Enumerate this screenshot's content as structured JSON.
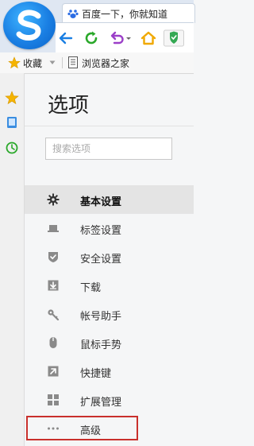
{
  "browser": {
    "tab": {
      "title": "百度一下，你就知道"
    },
    "toolbar": [
      "back-arrow-icon",
      "refresh-icon",
      "undo-icon",
      "home-icon",
      "shield-icon"
    ]
  },
  "bookmarks": {
    "favorites_label": "收藏",
    "site_label": "浏览器之家"
  },
  "sidebar_rail": [
    "star-icon",
    "tablet-icon",
    "clock-icon"
  ],
  "page": {
    "title": "选项",
    "search_placeholder": "搜索选项"
  },
  "menu": {
    "items": [
      {
        "label": "基本设置",
        "icon": "gear-icon",
        "active": true
      },
      {
        "label": "标签设置",
        "icon": "laptop-icon",
        "active": false
      },
      {
        "label": "安全设置",
        "icon": "shield-check-icon",
        "active": false
      },
      {
        "label": "下载",
        "icon": "download-icon",
        "active": false
      },
      {
        "label": "帐号助手",
        "icon": "key-icon",
        "active": false
      },
      {
        "label": "鼠标手势",
        "icon": "mouse-icon",
        "active": false
      },
      {
        "label": "快捷键",
        "icon": "arrow-box-icon",
        "active": false
      },
      {
        "label": "扩展管理",
        "icon": "grid-icon",
        "active": false
      },
      {
        "label": "高级",
        "icon": "more-dots-icon",
        "active": false
      }
    ]
  },
  "colors": {
    "accent_blue": "#1a7fe3",
    "active_item_bg": "#e4e4e4",
    "highlight_border": "#c9302c",
    "icon_gray": "#8a8a8a"
  }
}
